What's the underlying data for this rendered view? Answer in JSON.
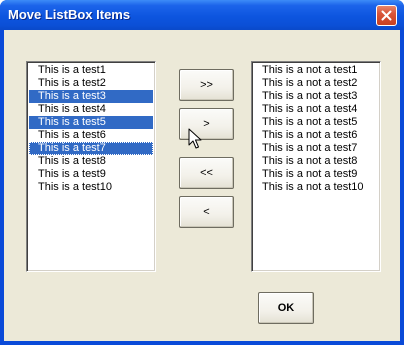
{
  "window": {
    "title": "Move ListBox Items",
    "colors": {
      "titlebar": "#0d55df",
      "client": "#ece9d8",
      "selection": "#316ac5",
      "close_button": "#d9553a"
    }
  },
  "left_list": {
    "items": [
      {
        "label": "This is a test1",
        "selected": false
      },
      {
        "label": "This is a test2",
        "selected": false
      },
      {
        "label": "This is a test3",
        "selected": true
      },
      {
        "label": "This is a test4",
        "selected": false
      },
      {
        "label": "This is a test5",
        "selected": true
      },
      {
        "label": "This is a test6",
        "selected": false
      },
      {
        "label": "This is a test7",
        "selected": true
      },
      {
        "label": "This is a test8",
        "selected": false
      },
      {
        "label": "This is a test9",
        "selected": false
      },
      {
        "label": "This is a test10",
        "selected": false
      }
    ]
  },
  "right_list": {
    "items": [
      {
        "label": "This is a not a test1"
      },
      {
        "label": "This is a not a test2"
      },
      {
        "label": "This is a not a test3"
      },
      {
        "label": "This is a not a test4"
      },
      {
        "label": "This is a not a test5"
      },
      {
        "label": "This is a not a test6"
      },
      {
        "label": "This is a not a test7"
      },
      {
        "label": "This is a not a test8"
      },
      {
        "label": "This is a not a test9"
      },
      {
        "label": "This is a not a test10"
      }
    ]
  },
  "buttons": {
    "move_all_right": ">>",
    "move_right": ">",
    "move_all_left": "<<",
    "move_left": "<",
    "ok": "OK"
  },
  "icons": {
    "close": "close-icon",
    "cursor": "mouse-pointer-icon"
  }
}
